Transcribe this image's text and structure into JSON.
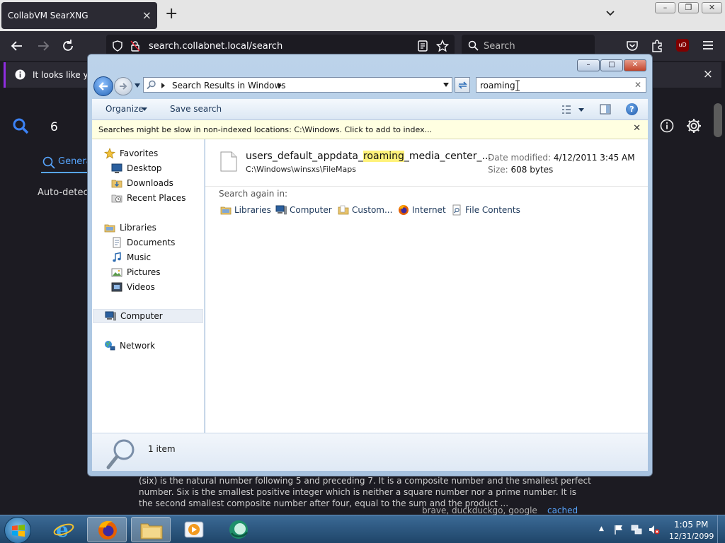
{
  "browser": {
    "tab_title": "CollabVM SearXNG",
    "tab_close": "×",
    "new_tab": "+",
    "url": "search.collabnet.local/search",
    "search_placeholder": "Search",
    "ublock_label": "uD",
    "notification_text": "It looks like you",
    "notification_close": "×"
  },
  "page": {
    "search_value": "6",
    "tab_general": "Genera",
    "autodetect": "Auto-detect",
    "snippet": "(six) is the natural number following 5 and preceding 7. It is a composite number and the smallest perfect number. Six is the smallest positive integer which is neither a square number nor a prime number. It is the second smallest composite number after four, equal to the sum and the product ...",
    "engines": "brave, duckduckgo, google",
    "cached": "cached"
  },
  "explorer": {
    "breadcrumb": "Search Results in Windows",
    "search_query": "roaming",
    "toolbar": {
      "organize": "Organize",
      "save_search": "Save search",
      "help": "?"
    },
    "info_bar": "Searches might be slow in non-indexed locations: C:\\Windows. Click to add to index...",
    "nav": {
      "favorites": "Favorites",
      "desktop": "Desktop",
      "downloads": "Downloads",
      "recent": "Recent Places",
      "libraries": "Libraries",
      "documents": "Documents",
      "music": "Music",
      "pictures": "Pictures",
      "videos": "Videos",
      "computer": "Computer",
      "network": "Network"
    },
    "result": {
      "name_prefix": "users_default_appdata_",
      "name_highlight": "roaming",
      "name_suffix": "_media_center_...",
      "path": "C:\\Windows\\winsxs\\FileMaps",
      "date_label": "Date modified:",
      "date_value": "4/12/2011 3:45 AM",
      "size_label": "Size:",
      "size_value": "608 bytes"
    },
    "search_again": {
      "label": "Search again in:",
      "libraries": "Libraries",
      "computer": "Computer",
      "custom": "Custom...",
      "internet": "Internet",
      "file_contents": "File Contents"
    },
    "item_count": "1 item"
  },
  "taskbar": {
    "time": "1:05 PM",
    "date": "12/31/2099"
  }
}
